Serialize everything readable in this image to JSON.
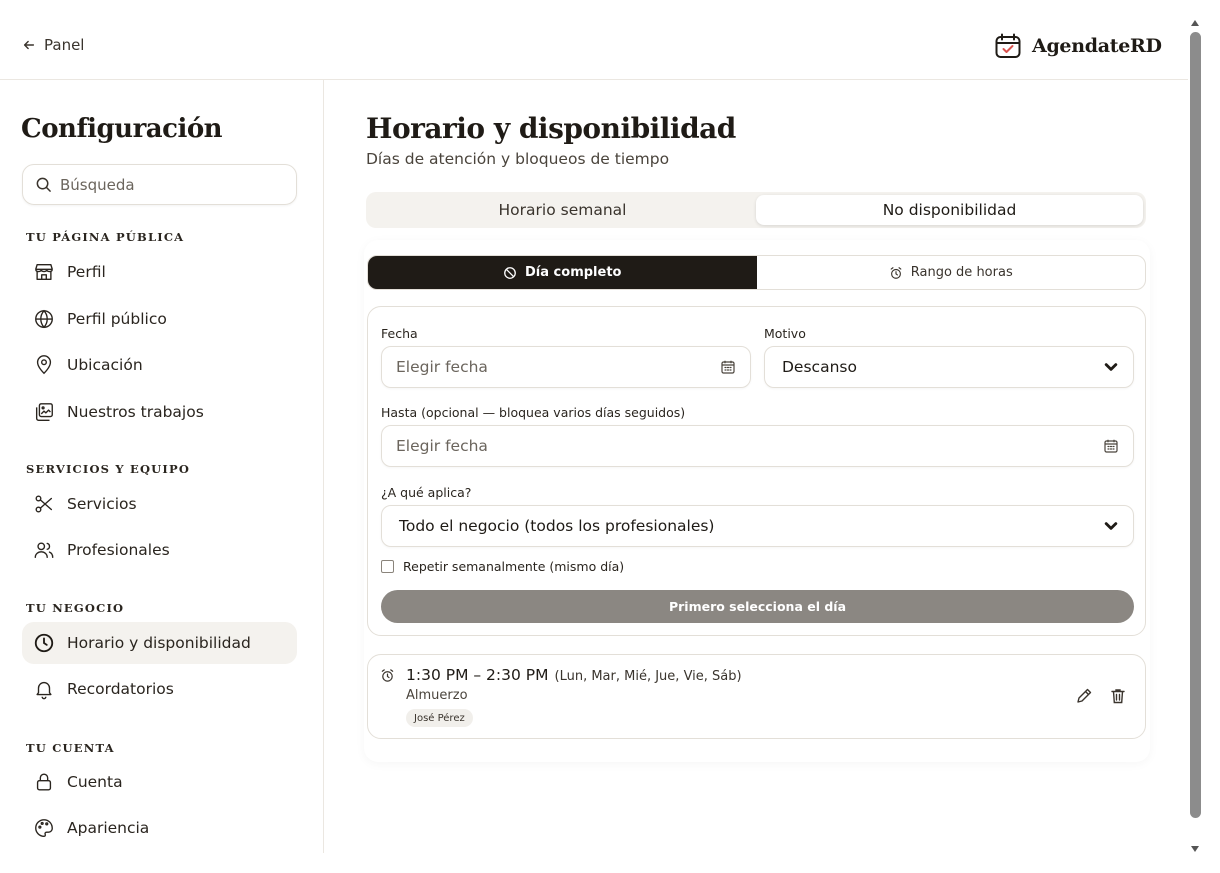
{
  "header": {
    "back_label": "Panel",
    "brand_name": "AgendateRD"
  },
  "sidebar": {
    "title": "Configuración",
    "search_placeholder": "Búsqueda",
    "sections": [
      {
        "label": "Tu página pública",
        "items": [
          {
            "label": "Perfil",
            "icon": "store-icon"
          },
          {
            "label": "Perfil público",
            "icon": "globe-icon"
          },
          {
            "label": "Ubicación",
            "icon": "map-pin-icon"
          },
          {
            "label": "Nuestros trabajos",
            "icon": "gallery-icon"
          }
        ]
      },
      {
        "label": "Servicios y equipo",
        "items": [
          {
            "label": "Servicios",
            "icon": "scissors-icon"
          },
          {
            "label": "Profesionales",
            "icon": "users-icon"
          }
        ]
      },
      {
        "label": "Tu negocio",
        "items": [
          {
            "label": "Horario y disponibilidad",
            "icon": "clock-icon",
            "active": true
          },
          {
            "label": "Recordatorios",
            "icon": "bell-icon"
          }
        ]
      },
      {
        "label": "Tu cuenta",
        "items": [
          {
            "label": "Cuenta",
            "icon": "lock-icon"
          },
          {
            "label": "Apariencia",
            "icon": "palette-icon"
          }
        ]
      }
    ]
  },
  "main": {
    "title": "Horario y disponibilidad",
    "subtitle": "Días de atención y bloqueos de tiempo",
    "tabs": [
      {
        "label": "Horario semanal",
        "active": false
      },
      {
        "label": "No disponibilidad",
        "active": true
      }
    ],
    "modes": [
      {
        "label": "Día completo",
        "icon": "ban-icon",
        "active": true
      },
      {
        "label": "Rango de horas",
        "icon": "alarm-icon",
        "active": false
      }
    ],
    "form": {
      "date_label": "Fecha",
      "date_placeholder": "Elegir fecha",
      "reason_label": "Motivo",
      "reason_value": "Descanso",
      "until_label": "Hasta (opcional — bloquea varios días seguidos)",
      "until_placeholder": "Elegir fecha",
      "applies_label": "¿A qué aplica?",
      "applies_value": "Todo el negocio (todos los profesionales)",
      "repeat_label": "Repetir semanalmente (mismo día)",
      "submit_label": "Primero selecciona el día"
    },
    "entries": [
      {
        "time": "1:30 PM – 2:30 PM",
        "days": "(Lun, Mar, Mié, Jue, Vie, Sáb)",
        "reason": "Almuerzo",
        "professional": "José Pérez"
      }
    ]
  },
  "colors": {
    "primary": "#1f1b16",
    "border": "#e3dfd8",
    "muted_button": "#8b8782",
    "active_bg": "#f4f2ee",
    "brand_accent": "#d9534f"
  }
}
